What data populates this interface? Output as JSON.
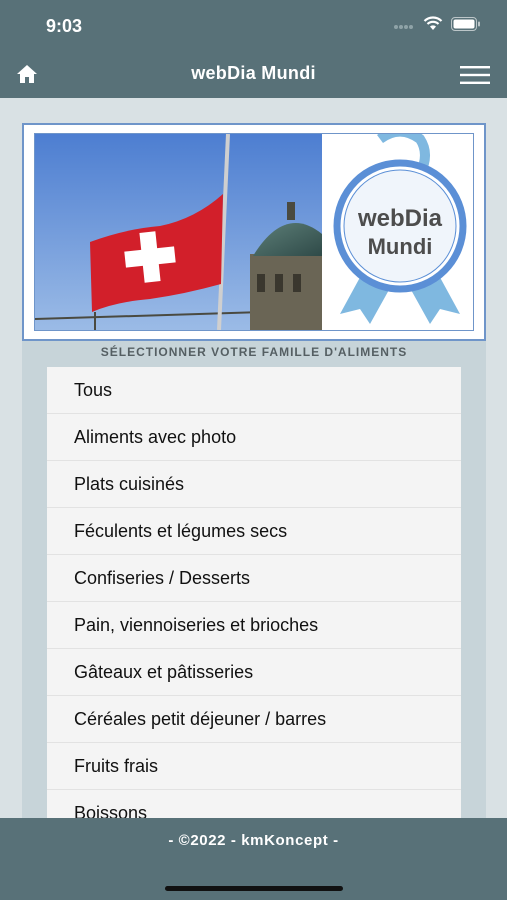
{
  "status_bar": {
    "time": "9:03"
  },
  "nav": {
    "title": "webDia Mundi",
    "home_icon": "home-icon",
    "menu_icon": "hamburger-menu-icon"
  },
  "banner": {
    "logo_line1": "webDia",
    "logo_line2": "Mundi"
  },
  "section": {
    "header": "SÉLECTIONNER VOTRE FAMILLE D'ALIMENTS"
  },
  "list": {
    "items": [
      {
        "label": "Tous"
      },
      {
        "label": "Aliments avec photo"
      },
      {
        "label": "Plats cuisinés"
      },
      {
        "label": "Féculents et légumes secs"
      },
      {
        "label": "Confiseries / Desserts"
      },
      {
        "label": "Pain, viennoiseries et brioches"
      },
      {
        "label": "Gâteaux et pâtisseries"
      },
      {
        "label": "Céréales petit déjeuner / barres"
      },
      {
        "label": "Fruits frais"
      },
      {
        "label": "Boissons"
      }
    ]
  },
  "footer": {
    "text": "- ©2022 - kmKoncept -"
  },
  "colors": {
    "bar": "#587178",
    "background": "#d9e1e4",
    "ribbon": "#7fb8e0",
    "logo_border": "#5b8fd6"
  }
}
